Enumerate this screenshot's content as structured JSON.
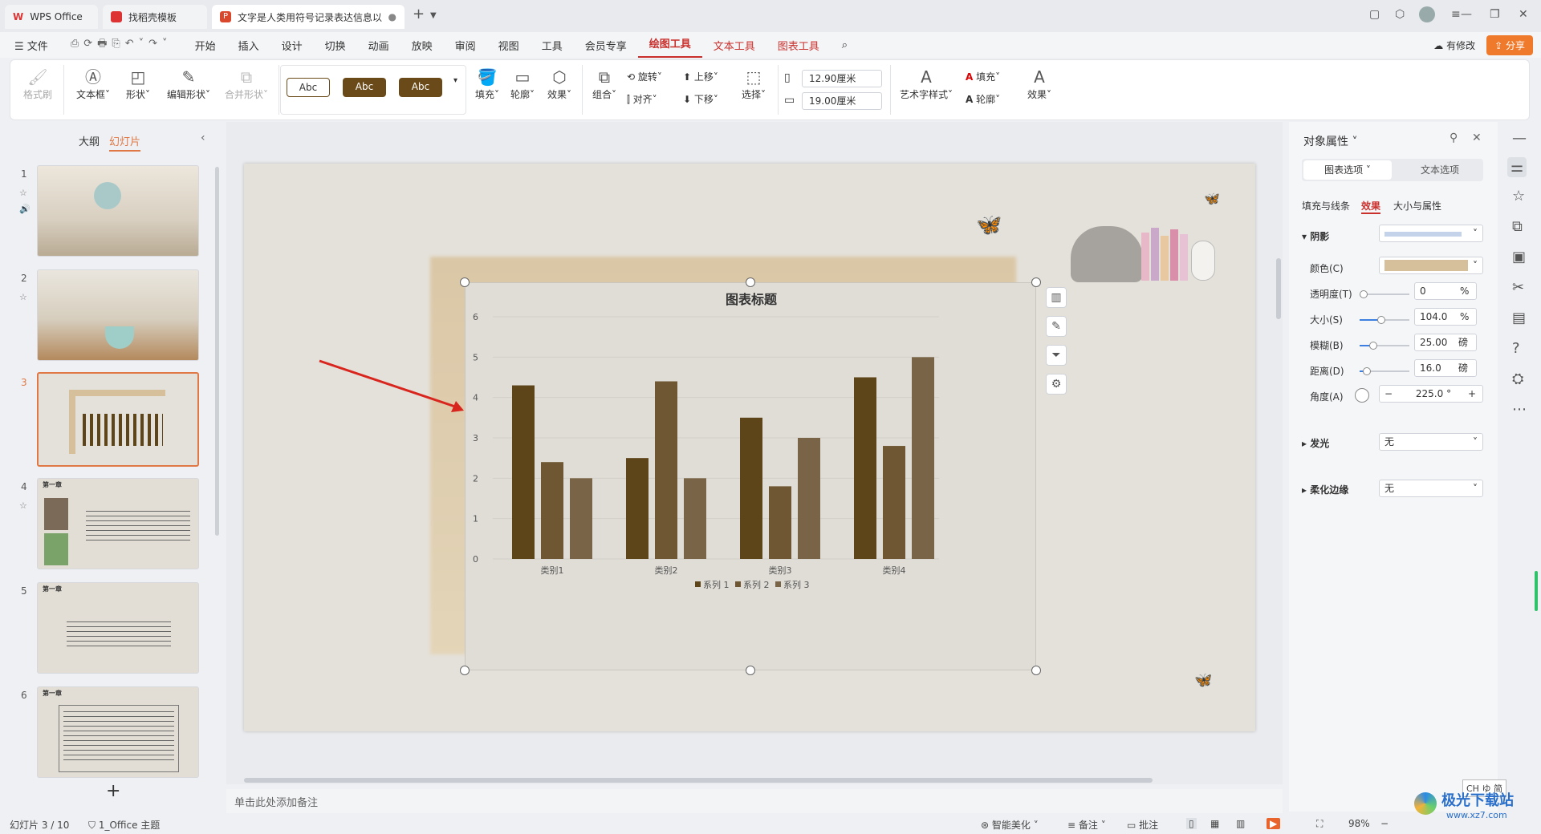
{
  "tabs": [
    {
      "label": "WPS Office"
    },
    {
      "label": "找稻壳模板"
    },
    {
      "label": "文字是人类用符号记录表达信息以"
    }
  ],
  "menu": {
    "file": "文件",
    "items": [
      "开始",
      "插入",
      "设计",
      "切换",
      "动画",
      "放映",
      "审阅",
      "视图",
      "工具",
      "会员专享"
    ],
    "drawing_tools": "绘图工具",
    "text_tools": "文本工具",
    "chart_tools": "图表工具",
    "has_changes": "有修改",
    "share": "分享"
  },
  "ribbon": {
    "format_painter": "格式刷",
    "textbox": "文本框",
    "shape": "形状",
    "edit_shape": "编辑形状",
    "merge_shape": "合并形状",
    "abc1": "Abc",
    "abc2": "Abc",
    "abc3": "Abc",
    "fill": "填充",
    "outline": "轮廓",
    "effect": "效果",
    "group": "组合",
    "rotate": "旋转",
    "align": "对齐",
    "up": "上移",
    "down": "下移",
    "select": "选择",
    "height": "12.90厘米",
    "width": "19.00厘米",
    "art_style": "艺术字样式",
    "fill2": "填充",
    "outline2": "轮廓",
    "effect2": "效果"
  },
  "left": {
    "outline_tab": "大纲",
    "slides_tab": "幻灯片",
    "slide_numbers": [
      "1",
      "2",
      "3",
      "4",
      "5",
      "6"
    ],
    "heading": "第一章"
  },
  "chart_data": {
    "type": "bar",
    "title": "图表标题",
    "categories": [
      "类别1",
      "类别2",
      "类别3",
      "类别4"
    ],
    "series": [
      {
        "name": "系列 1",
        "values": [
          4.3,
          2.5,
          3.5,
          4.5
        ],
        "color": "#5e4419"
      },
      {
        "name": "系列 2",
        "values": [
          2.4,
          4.4,
          1.8,
          2.8
        ],
        "color": "#6e5732"
      },
      {
        "name": "系列 3",
        "values": [
          2.0,
          2.0,
          3.0,
          5.0
        ],
        "color": "#7a6447"
      }
    ],
    "ylim": [
      0,
      6
    ],
    "yticks": [
      "0",
      "1",
      "2",
      "3",
      "4",
      "5",
      "6"
    ],
    "legend": "bottom",
    "grid": true
  },
  "notes_placeholder": "单击此处添加备注",
  "right": {
    "title": "对象属性",
    "tab_chart": "图表选项",
    "tab_text": "文本选项",
    "sub_fill": "填充与线条",
    "sub_effect": "效果",
    "sub_size": "大小与属性",
    "shadow": "阴影",
    "color_label": "颜色(C)",
    "shadow_color": "#d6c09b",
    "transparency_label": "透明度(T)",
    "transparency": "0",
    "transparency_unit": "%",
    "size_label": "大小(S)",
    "size": "104.0",
    "size_unit": "%",
    "blur_label": "模糊(B)",
    "blur": "25.00",
    "blur_unit": "磅",
    "distance_label": "距离(D)",
    "distance": "16.0",
    "distance_unit": "磅",
    "angle_label": "角度(A)",
    "angle": "225.0",
    "angle_unit": "°",
    "glow": "发光",
    "glow_value": "无",
    "soft_edge": "柔化边缘",
    "soft_edge_value": "无"
  },
  "status": {
    "slide_info": "幻灯片 3 / 10",
    "theme": "1_Office 主题",
    "beautify": "智能美化",
    "notes": "备注",
    "comment": "批注",
    "zoom": "98%",
    "ime": "CH ゆ 简",
    "watermark": "极光下载站",
    "watermark_url": "www.xz7.com"
  }
}
